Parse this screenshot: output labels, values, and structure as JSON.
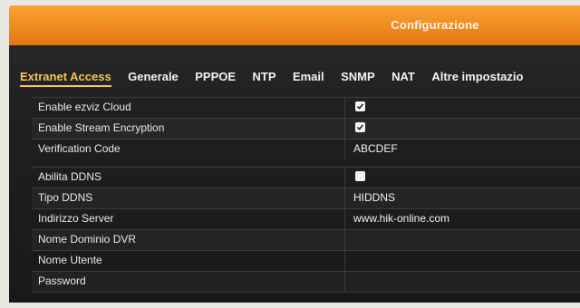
{
  "window": {
    "title": "Configurazione"
  },
  "tabs": [
    {
      "label": "Extranet Access",
      "active": true
    },
    {
      "label": "Generale"
    },
    {
      "label": "PPPOE"
    },
    {
      "label": "NTP"
    },
    {
      "label": "Email"
    },
    {
      "label": "SNMP"
    },
    {
      "label": "NAT"
    },
    {
      "label": "Altre impostazio"
    }
  ],
  "settings": [
    {
      "label": "Enable ezviz Cloud",
      "type": "checkbox",
      "checked": true
    },
    {
      "label": "Enable Stream Encryption",
      "type": "checkbox",
      "checked": true
    },
    {
      "label": "Verification Code",
      "type": "text",
      "value": "ABCDEF"
    },
    {
      "label": "Abilita DDNS",
      "type": "checkbox",
      "checked": false
    },
    {
      "label": "Tipo DDNS",
      "type": "text",
      "value": "HIDDNS"
    },
    {
      "label": "Indirizzo Server",
      "type": "text",
      "value": "www.hik-online.com"
    },
    {
      "label": "Nome Dominio DVR",
      "type": "text",
      "value": ""
    },
    {
      "label": "Nome Utente",
      "type": "text",
      "value": ""
    },
    {
      "label": "Password",
      "type": "text",
      "value": ""
    }
  ],
  "colors": {
    "accent": "#ef8a1e",
    "active_tab": "#f6c64e",
    "panel": "#1e1f21"
  }
}
